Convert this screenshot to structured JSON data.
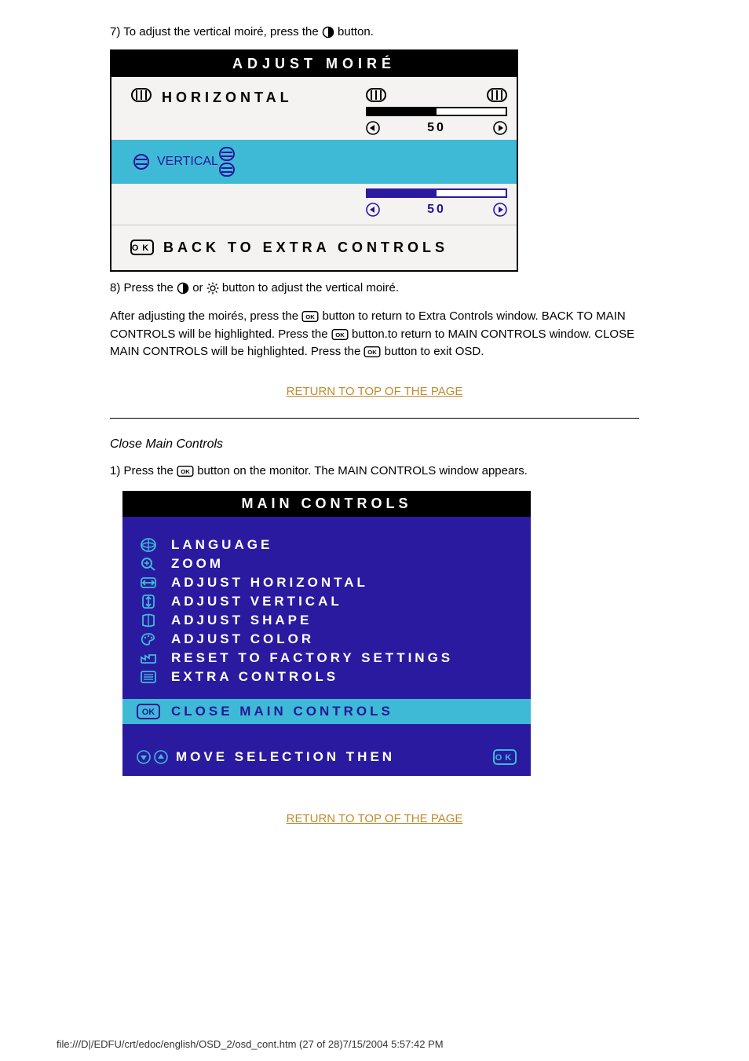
{
  "instructions": {
    "step7_pre": "7) To adjust the vertical moiré, press the",
    "step7_post": "button.",
    "step8_pre": "8) Press the",
    "step8_mid": "or",
    "step8_post": "button to adjust the vertical moiré.",
    "after_text_pre": "After adjusting the moirés, press the",
    "after_text_mid1": "button to return to Extra Controls window. BACK TO MAIN CONTROLS will be highlighted. Press the",
    "after_text_mid2": "button.to return to MAIN CONTROLS window. CLOSE MAIN CONTROLS will be highlighted. Press the",
    "after_text_post": "button to exit OSD.",
    "section2_step1_pre": "1) Press the",
    "section2_step1_post": "button on the monitor. The MAIN CONTROLS window appears."
  },
  "osd1": {
    "title": "ADJUST MOIRÉ",
    "horizontal_label": "HORIZONTAL",
    "vertical_label": "VERTICAL",
    "horizontal_value": "50",
    "vertical_value": "50",
    "back_label": "BACK TO EXTRA CONTROLS"
  },
  "link_text": "RETURN TO TOP OF THE PAGE",
  "section_title": "Close Main Controls",
  "osd2": {
    "title": "MAIN CONTROLS",
    "items": [
      {
        "label": "LANGUAGE",
        "icon": "globe-icon"
      },
      {
        "label": "ZOOM",
        "icon": "zoom-icon"
      },
      {
        "label": "ADJUST HORIZONTAL",
        "icon": "h-arrow-icon"
      },
      {
        "label": "ADJUST VERTICAL",
        "icon": "v-arrow-icon"
      },
      {
        "label": "ADJUST SHAPE",
        "icon": "shape-icon"
      },
      {
        "label": "ADJUST COLOR",
        "icon": "palette-icon"
      },
      {
        "label": "RESET TO FACTORY SETTINGS",
        "icon": "factory-icon"
      },
      {
        "label": "EXTRA CONTROLS",
        "icon": "list-icon"
      }
    ],
    "close_label": "CLOSE MAIN CONTROLS",
    "hint_label": "MOVE SELECTION THEN"
  },
  "footer": {
    "path": "file:///D|/EDFU/crt/edoc/english/OSD_2/osd_cont.htm (27 of 28)7/15/2004 5:57:42 PM"
  }
}
